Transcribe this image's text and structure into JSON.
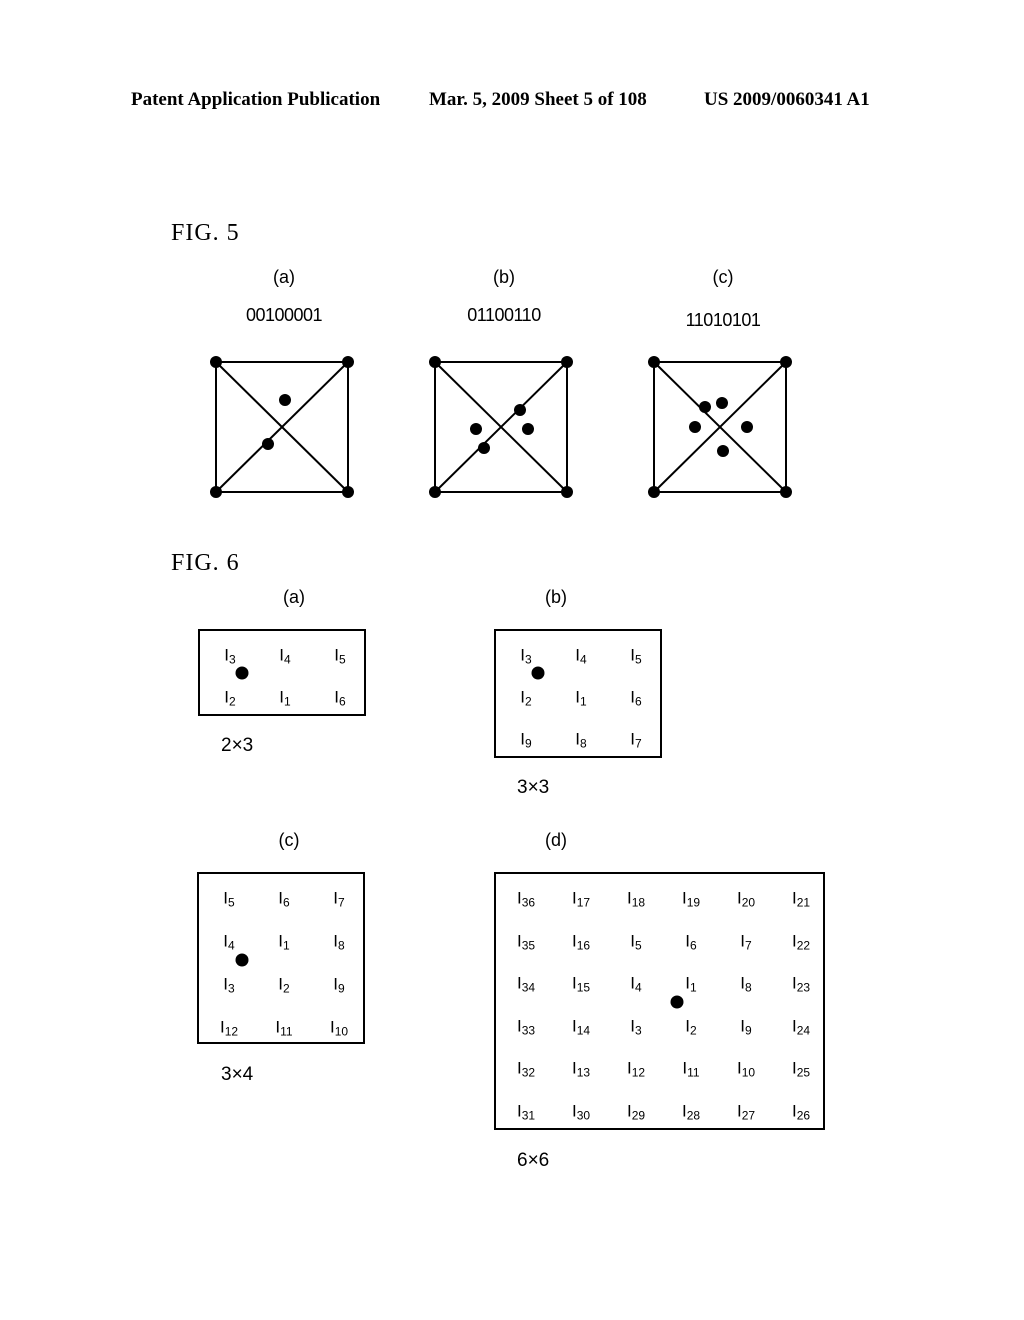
{
  "header": {
    "publication": "Patent Application Publication",
    "date_sheet": "Mar. 5, 2009   Sheet 5 of 108",
    "number": "US 2009/0060341 A1"
  },
  "fig5": {
    "label": "FIG. 5",
    "panels": [
      {
        "tag": "(a)",
        "code": "00100001",
        "dot_count": 2
      },
      {
        "tag": "(b)",
        "code": "01100110",
        "dot_count": 4
      },
      {
        "tag": "(c)",
        "code": "11010101",
        "dot_count": 5
      }
    ]
  },
  "fig6": {
    "label": "FIG. 6",
    "panels": [
      {
        "tag": "(a)",
        "size": "2×3",
        "cols": 3,
        "rows": 2,
        "cells": [
          [
            "3",
            "4",
            "5"
          ],
          [
            "2",
            "1",
            "6"
          ]
        ]
      },
      {
        "tag": "(b)",
        "size": "3×3",
        "cols": 3,
        "rows": 3,
        "cells": [
          [
            "3",
            "4",
            "5"
          ],
          [
            "2",
            "1",
            "6"
          ],
          [
            "9",
            "8",
            "7"
          ]
        ]
      },
      {
        "tag": "(c)",
        "size": "3×4",
        "cols": 3,
        "rows": 4,
        "cells": [
          [
            "5",
            "6",
            "7"
          ],
          [
            "4",
            "1",
            "8"
          ],
          [
            "3",
            "2",
            "9"
          ],
          [
            "12",
            "11",
            "10"
          ]
        ]
      },
      {
        "tag": "(d)",
        "size": "6×6",
        "cols": 6,
        "rows": 6,
        "cells": [
          [
            "36",
            "17",
            "18",
            "19",
            "20",
            "21"
          ],
          [
            "35",
            "16",
            "5",
            "6",
            "7",
            "22"
          ],
          [
            "34",
            "15",
            "4",
            "1",
            "8",
            "23"
          ],
          [
            "33",
            "14",
            "3",
            "2",
            "9",
            "24"
          ],
          [
            "32",
            "13",
            "12",
            "11",
            "10",
            "25"
          ],
          [
            "31",
            "30",
            "29",
            "28",
            "27",
            "26"
          ]
        ]
      }
    ],
    "cell_prefix": "I"
  }
}
